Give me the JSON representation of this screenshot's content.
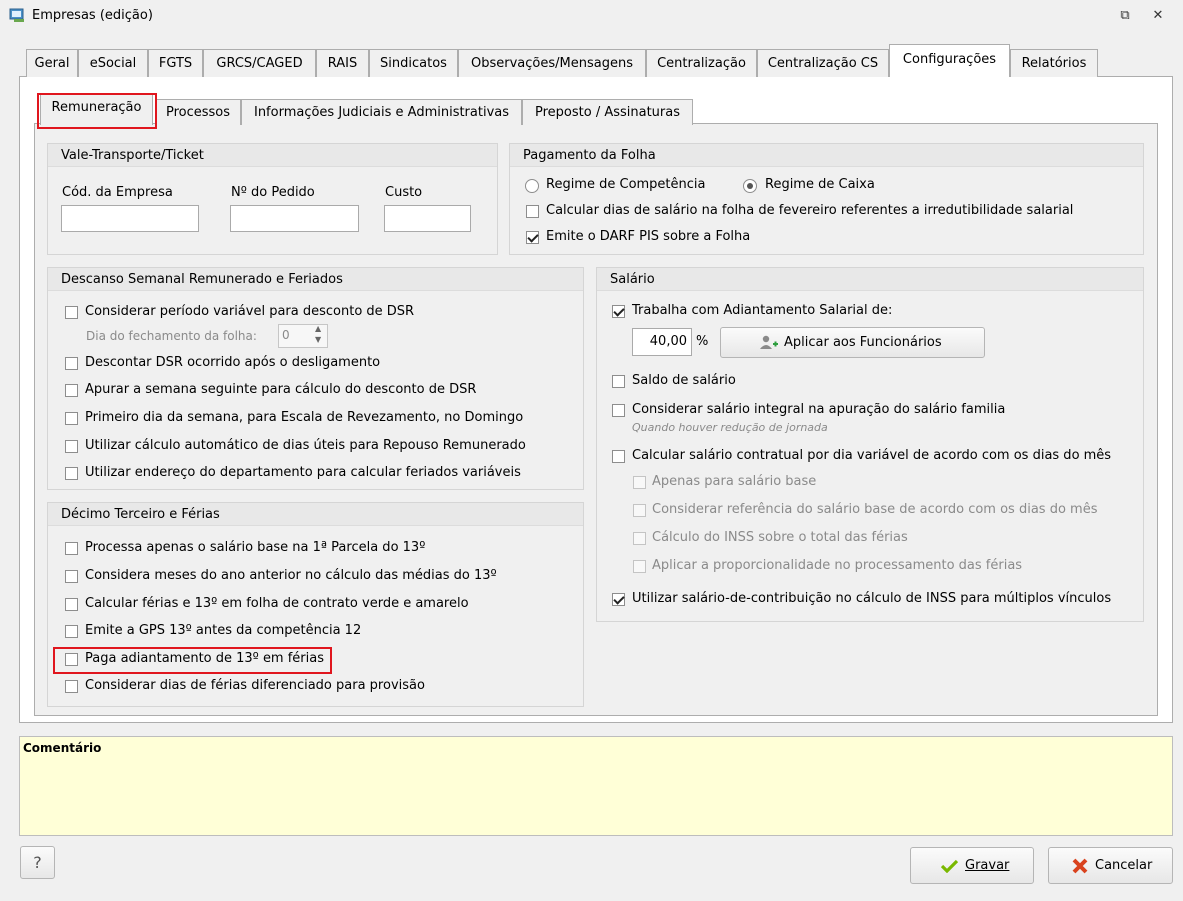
{
  "window": {
    "title": "Empresas (edição)",
    "restore_glyph": "⧉",
    "close_glyph": "✕"
  },
  "tabs": [
    {
      "label": "Geral"
    },
    {
      "label": "eSocial"
    },
    {
      "label": "FGTS"
    },
    {
      "label": "GRCS/CAGED"
    },
    {
      "label": "RAIS"
    },
    {
      "label": "Sindicatos"
    },
    {
      "label": "Observações/Mensagens"
    },
    {
      "label": "Centralização"
    },
    {
      "label": "Centralização CS"
    },
    {
      "label": "Configurações",
      "active": true
    },
    {
      "label": "Relatórios"
    }
  ],
  "subtabs": [
    {
      "label": "Remuneração",
      "active": true
    },
    {
      "label": "Processos"
    },
    {
      "label": "Informações Judiciais e Administrativas"
    },
    {
      "label": "Preposto / Assinaturas"
    }
  ],
  "vale": {
    "title": "Vale-Transporte/Ticket",
    "cod_label": "Cód. da Empresa",
    "pedido_label": "Nº do Pedido",
    "custo_label": "Custo",
    "cod_value": "",
    "pedido_value": "",
    "custo_value": ""
  },
  "pagamento": {
    "title": "Pagamento da Folha",
    "competencia": "Regime de Competência",
    "caixa": "Regime de Caixa",
    "selected": "caixa",
    "calcular_fevereiro": "Calcular dias de salário na folha de fevereiro referentes a irredutibilidade salarial",
    "calcular_fevereiro_checked": false,
    "darf_pis": "Emite o DARF PIS sobre a Folha",
    "darf_pis_checked": true
  },
  "dsr": {
    "title": "Descanso Semanal Remunerado e Feriados",
    "items": [
      {
        "label": "Considerar período variável para desconto de DSR",
        "checked": false
      },
      {
        "label": "Descontar DSR ocorrido após o desligamento",
        "checked": false
      },
      {
        "label": "Apurar a semana seguinte para cálculo do desconto de DSR",
        "checked": false
      },
      {
        "label": "Primeiro dia da semana, para Escala de Revezamento, no Domingo",
        "checked": false
      },
      {
        "label": "Utilizar cálculo automático de dias úteis para Repouso Remunerado",
        "checked": false
      },
      {
        "label": "Utilizar endereço do departamento para calcular feriados variáveis",
        "checked": false
      }
    ],
    "fechamento_label": "Dia do fechamento da folha:",
    "fechamento_value": "0"
  },
  "decimo": {
    "title": "Décimo Terceiro e Férias",
    "items": [
      {
        "label": "Processa apenas o salário base na 1ª Parcela do 13º",
        "checked": false
      },
      {
        "label": "Considera meses do ano anterior no cálculo das médias do 13º",
        "checked": false
      },
      {
        "label": "Calcular férias e 13º em folha de contrato verde e amarelo",
        "checked": false
      },
      {
        "label": "Emite a GPS 13º antes da competência 12",
        "checked": false
      },
      {
        "label": "Paga adiantamento de 13º em férias",
        "checked": false
      },
      {
        "label": "Considerar dias de férias diferenciado para provisão",
        "checked": false
      }
    ]
  },
  "salario": {
    "title": "Salário",
    "adiantamento_label": "Trabalha com Adiantamento Salarial de:",
    "adiantamento_checked": true,
    "percent_value": "40,00",
    "percent_symbol": "%",
    "aplicar_button": "Aplicar aos Funcionários",
    "saldo_label": "Saldo de salário",
    "saldo_checked": false,
    "integral_label": "Considerar salário integral na apuração do salário familia",
    "integral_checked": false,
    "integral_note": "Quando houver redução de jornada",
    "contratual_label": "Calcular salário contratual por dia variável de acordo com os dias do mês",
    "contratual_checked": false,
    "sub_items": [
      {
        "label": "Apenas para salário base"
      },
      {
        "label": "Considerar referência do salário base de acordo com os dias do mês"
      },
      {
        "label": "Cálculo do INSS sobre o total das férias"
      },
      {
        "label": "Aplicar a proporcionalidade no processamento das férias"
      }
    ],
    "multiplos_label": "Utilizar salário-de-contribuição no cálculo de INSS para múltiplos vínculos",
    "multiplos_checked": true
  },
  "comment": {
    "title": "Comentário",
    "text": ""
  },
  "footer": {
    "help_label": "?",
    "gravar_label": "Gravar",
    "cancelar_label": "Cancelar"
  },
  "colors": {
    "highlight": "#e0161e",
    "comment_bg": "#ffffd7",
    "gravar_icon": "#7ab800",
    "cancel_icon": "#d9431e"
  }
}
